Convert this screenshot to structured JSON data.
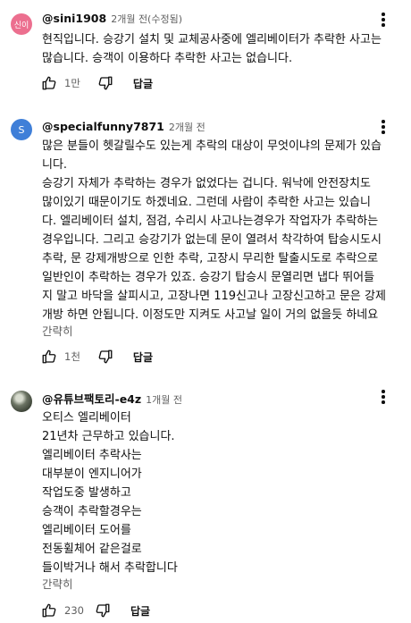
{
  "comments": [
    {
      "avatar_text": "신이",
      "author": "@sini1908",
      "time": "2개월 전(수정됨)",
      "lines": [
        "현직입니다. 승강기 설치 및 교체공사중에 엘리베이터가 추락한 사고는",
        "많습니다. 승객이 이용하다 추락한 사고는 없습니다."
      ],
      "likes": "1만",
      "reply_label": "답글"
    },
    {
      "avatar_text": "S",
      "author": "@specialfunny7871",
      "time": "2개월 전",
      "lines": [
        "많은 분들이 헷갈릴수도 있는게 추락의 대상이 무엇이냐의 문제가 있습",
        "니다.",
        "승강기 자체가 추락하는 경우가 없었다는 겁니다. 워낙에 안전장치도",
        "많이있기 때문이기도 하겠네요. 그런데 사람이 추락한 사고는 있습니",
        "다. 엘리베이터 설치, 점검, 수리시 사고나는경우가 작업자가 추락하는",
        "경우입니다. 그리고 승강기가 없는데 문이 열려서 착각하여 탑승시도시",
        "추락, 문 강제개방으로 인한 추락, 고장시 무리한 탈출시도로 추락으로",
        "일반인이 추락하는 경우가 있죠. 승강기 탑승시 문열리면 냅다 뛰어들",
        "지 말고 바닥을 살피시고, 고장나면 119신고나 고장신고하고 문은 강제",
        "개방 하면 안됩니다. 이정도만 지켜도 사고날 일이 거의 없을듯 하네요"
      ],
      "read_less": "간략히",
      "likes": "1천",
      "reply_label": "답글"
    },
    {
      "author": "@유튜브팩토리-e4z",
      "time": "1개월 전",
      "lines": [
        "오티스 엘리베이터",
        "21년차 근무하고 있습니다.",
        "엘리베이터 추락사는",
        "대부분이 엔지니어가",
        "작업도중 발생하고",
        "승객이 추락할경우는",
        "엘리베이터 도어를",
        "전동휠체어 같은걸로",
        "들이박거나 해서 추락합니다"
      ],
      "read_less": "간략히",
      "likes": "230",
      "reply_label": "답글"
    }
  ],
  "icons": {
    "like": "thumbs-up-icon",
    "dislike": "thumbs-down-icon",
    "menu": "more-vert-icon"
  }
}
